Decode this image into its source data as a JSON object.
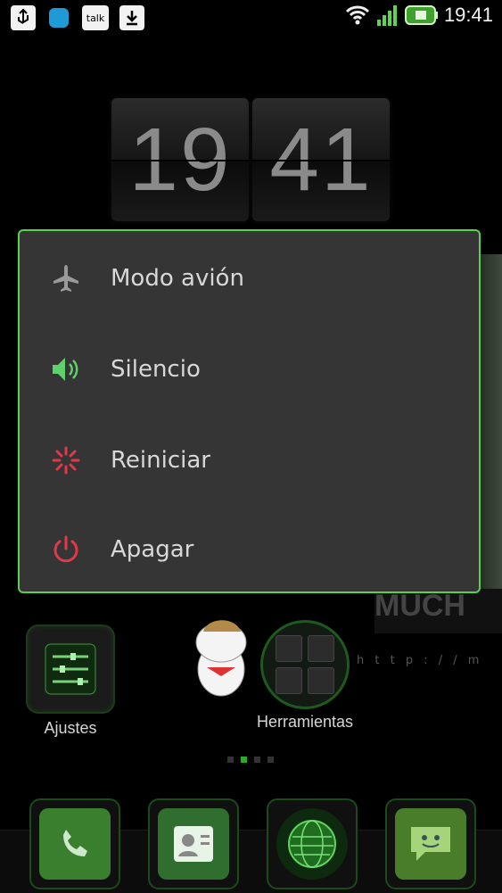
{
  "status_bar": {
    "icons_left": [
      "usb-icon",
      "app-square-icon",
      "talk-icon",
      "download-icon"
    ],
    "talk_label": "talk",
    "icons_right": [
      "wifi-icon",
      "signal-icon",
      "battery-icon"
    ],
    "time": "19:41"
  },
  "clock_widget": {
    "hours": "19",
    "minutes": "41"
  },
  "power_menu": {
    "items": [
      {
        "label": "Modo avión",
        "icon": "airplane-icon",
        "color": "#9a9a9a"
      },
      {
        "label": "Silencio",
        "icon": "speaker-icon",
        "color": "#5fd16b"
      },
      {
        "label": "Reiniciar",
        "icon": "restart-icon",
        "color": "#e03a4a"
      },
      {
        "label": "Apagar",
        "icon": "power-icon",
        "color": "#e03a4a"
      }
    ],
    "border_color": "#59d14a"
  },
  "desktop": {
    "apps": [
      {
        "label": "Ajustes",
        "icon": "settings-sliders-icon"
      },
      {
        "label": "Herramientas",
        "icon": "tools-folder-icon"
      }
    ],
    "page_indicator": {
      "count": 4,
      "active": 1
    },
    "background_text": "MUCH",
    "background_url_text": "h t t p : / / m"
  },
  "dock": {
    "items": [
      {
        "icon": "phone-icon"
      },
      {
        "icon": "contacts-icon"
      },
      {
        "icon": "browser-globe-icon"
      },
      {
        "icon": "messaging-icon"
      }
    ]
  }
}
